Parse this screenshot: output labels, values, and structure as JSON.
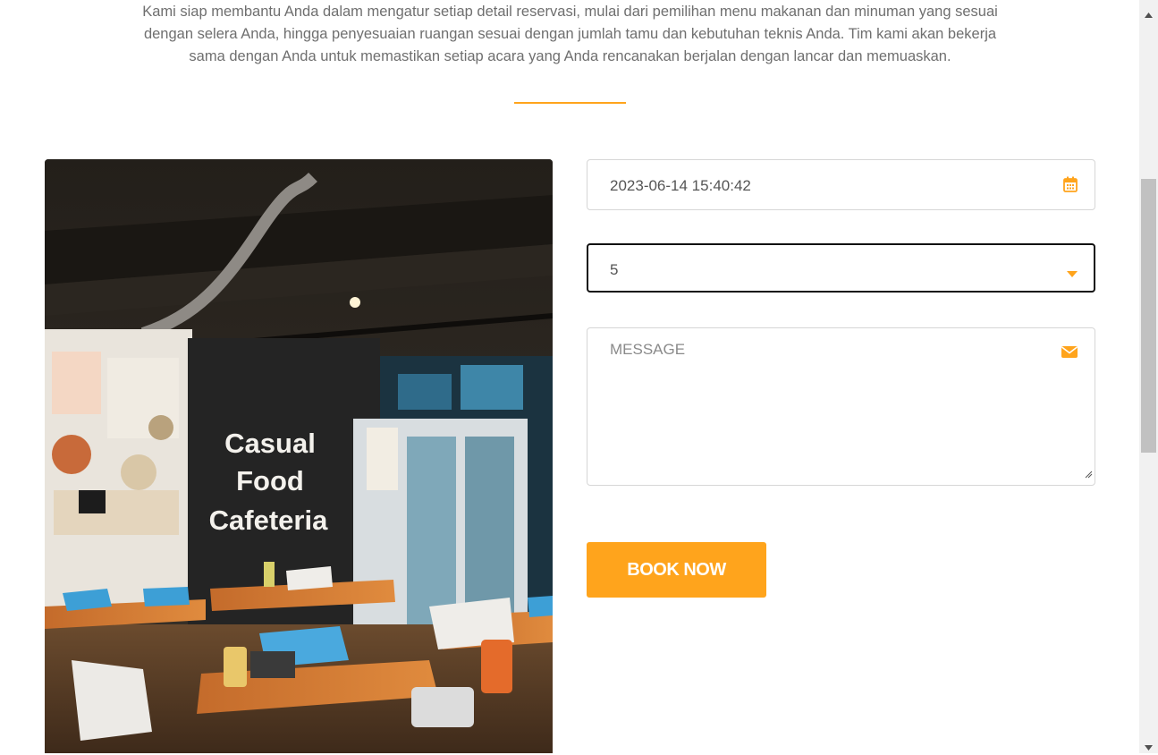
{
  "intro": {
    "text": "Kami siap membantu Anda dalam mengatur setiap detail reservasi, mulai dari pemilihan menu makanan dan minuman yang sesuai dengan selera Anda, hingga penyesuaian ruangan sesuai dengan jumlah tamu dan kebutuhan teknis Anda. Tim kami akan bekerja sama dengan Anda untuk memastikan setiap acara yang Anda rencanakan berjalan dengan lancar dan memuaskan."
  },
  "photo": {
    "sign_line1": "Casual",
    "sign_line2": "Food",
    "sign_line3": "Cafeteria"
  },
  "form": {
    "datetime_value": "2023-06-14 15:40:42",
    "guests_value": "5",
    "message_placeholder": "MESSAGE",
    "submit_label": "BOOK NOW"
  },
  "icons": {
    "datetime": "calendar-icon",
    "guests": "caret-down-icon",
    "message": "envelope-icon"
  },
  "colors": {
    "accent": "#ffa41c",
    "text": "#6f6f6f",
    "border": "#d6d6d6"
  }
}
